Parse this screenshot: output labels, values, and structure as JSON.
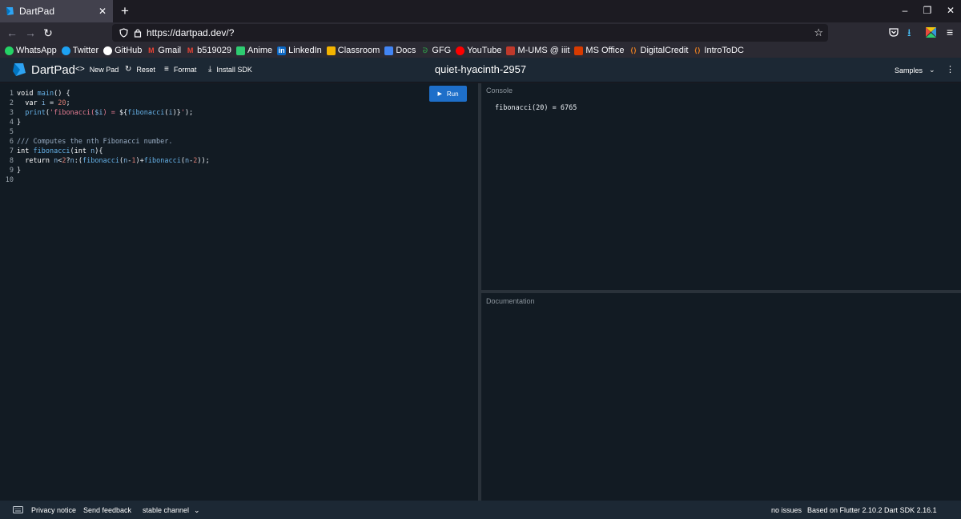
{
  "browser": {
    "tab_title": "DartPad",
    "url": "https://dartpad.dev/?",
    "bookmarks": [
      "WhatsApp",
      "Twitter",
      "GitHub",
      "Gmail",
      "b519029",
      "Anime",
      "LinkedIn",
      "Classroom",
      "Docs",
      "GFG",
      "YouTube",
      "M-UMS @ iiit",
      "MS Office",
      "DigitalCredit",
      "IntroToDC"
    ]
  },
  "header": {
    "logo": "DartPad",
    "new_pad": "New Pad",
    "reset": "Reset",
    "format": "Format",
    "install_sdk": "Install SDK",
    "pad_name": "quiet-hyacinth-2957",
    "samples": "Samples"
  },
  "editor": {
    "run_label": "Run",
    "line_numbers": [
      "1",
      "2",
      "3",
      "4",
      "5",
      "6",
      "7",
      "8",
      "9",
      "10"
    ]
  },
  "console": {
    "label": "Console",
    "output": "fibonacci(20) = 6765"
  },
  "docs": {
    "label": "Documentation"
  },
  "footer": {
    "privacy": "Privacy notice",
    "feedback": "Send feedback",
    "channel": "stable channel",
    "issues": "no issues",
    "version": "Based on Flutter 2.10.2 Dart SDK 2.16.1"
  },
  "colors": {
    "run_button": "#1e6fc9",
    "header_bg": "#1c2834",
    "editor_bg": "#121b23"
  }
}
